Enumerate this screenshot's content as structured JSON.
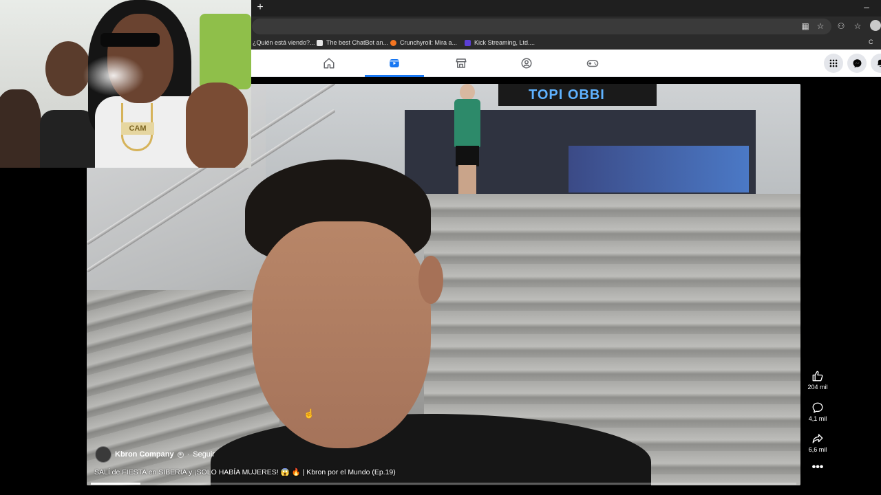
{
  "browser": {
    "new_tab_glyph": "+",
    "minimize_glyph": "–",
    "profile_initial": "",
    "bookmarks": [
      {
        "label": "¿Quién está viendo?...",
        "color": "#e50914"
      },
      {
        "label": "The best ChatBot an...",
        "color": "#e6e6e6"
      },
      {
        "label": "Crunchyroll: Mira a...",
        "color": "#f47521"
      },
      {
        "label": "Kick Streaming, Ltd....",
        "color": "#5b3fd6"
      }
    ],
    "bookmarks_folder_glyph": "C"
  },
  "facebook": {
    "accent": "#1877f2",
    "nav_tabs": [
      {
        "name": "home-icon",
        "active": false
      },
      {
        "name": "video-icon",
        "active": true
      },
      {
        "name": "marketplace-icon",
        "active": false
      },
      {
        "name": "groups-icon",
        "active": false
      },
      {
        "name": "gaming-icon",
        "active": false
      }
    ],
    "right_buttons": [
      "menu-grid-icon",
      "messenger-icon",
      "notifications-icon"
    ]
  },
  "video": {
    "sign_text": "TOPI OBBI",
    "owner_name": "Kbron Company",
    "separator": "·",
    "follow_label": "Seguir",
    "caption": "SALÍ de FIESTA en SIBERIA y ¡SOLO HABÍA MUJERES! 😱 🔥 | Kbron por el Mundo (Ep.19)",
    "progress_fraction": 0.07
  },
  "actions": {
    "likes": "204 mil",
    "comments": "4,1 mil",
    "shares": "6,6 mil",
    "more_glyph": "•••"
  },
  "pip": {
    "pendant_text": "CAM"
  }
}
